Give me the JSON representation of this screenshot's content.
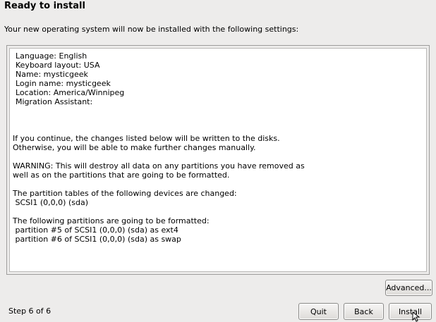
{
  "header": {
    "title": "Ready to install"
  },
  "intro": "Your new operating system will now be installed with the following settings:",
  "summary": {
    "lines": [
      "Language: English",
      "Keyboard layout: USA",
      "Name: mysticgeek",
      "Login name: mysticgeek",
      "Location: America/Winnipeg",
      "Migration Assistant:",
      "If you continue, the changes listed below will be written to the disks.",
      "Otherwise, you will be able to make further changes manually.",
      "WARNING: This will destroy all data on any partitions you have removed as",
      "well as on the partitions that are going to be formatted.",
      "The partition tables of the following devices are changed:",
      " SCSI1 (0,0,0) (sda)",
      "The following partitions are going to be formatted:",
      " partition #5 of SCSI1 (0,0,0) (sda) as ext4",
      " partition #6 of SCSI1 (0,0,0) (sda) as swap"
    ]
  },
  "buttons": {
    "advanced": "Advanced...",
    "quit": "Quit",
    "back": "Back",
    "install": "Install"
  },
  "footer": {
    "step": "Step 6 of 6"
  },
  "icons": {
    "cursor": "mouse-pointer-icon"
  }
}
